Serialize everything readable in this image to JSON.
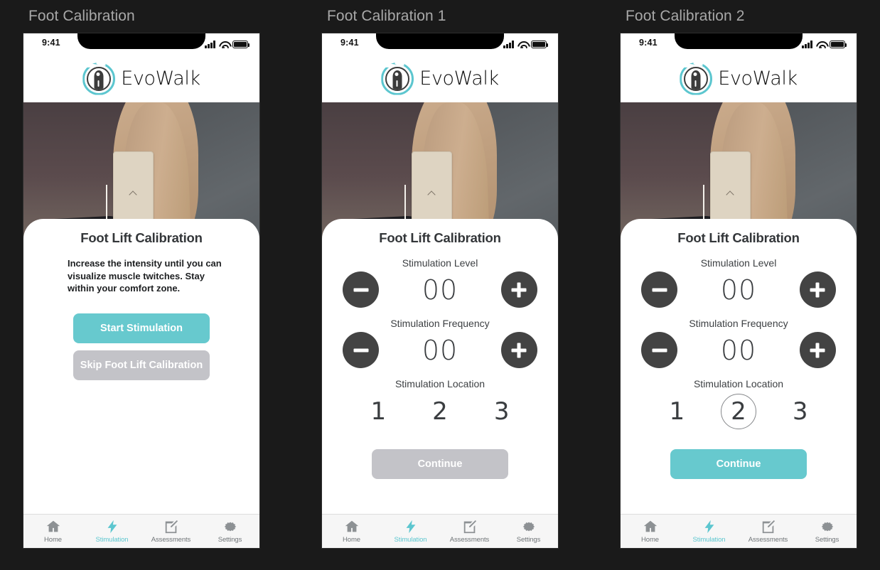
{
  "background_color": "#1a1a1a",
  "accent_color": "#67c9ce",
  "panels": [
    {
      "title": "Foot Calibration"
    },
    {
      "title": "Foot Calibration 1"
    },
    {
      "title": "Foot Calibration 2"
    }
  ],
  "status_bar": {
    "time": "9:41"
  },
  "brand": {
    "name": "EvoWalk"
  },
  "card_title": "Foot Lift Calibration",
  "screen1": {
    "description": "Increase the intensity until you can visualize muscle twitches. Stay within your comfort zone.",
    "start_button": "Start Stimulation",
    "skip_button": "Skip Foot Lift Calibration"
  },
  "screen2": {
    "level_label": "Stimulation Level",
    "level_value": "00",
    "frequency_label": "Stimulation Frequency",
    "frequency_value": "00",
    "location_label": "Stimulation Location",
    "location_options": [
      "1",
      "2",
      "3"
    ],
    "location_selected": null,
    "continue_button": "Continue",
    "continue_enabled": false
  },
  "screen3": {
    "level_label": "Stimulation Level",
    "level_value": "00",
    "frequency_label": "Stimulation Frequency",
    "frequency_value": "00",
    "location_label": "Stimulation Location",
    "location_options": [
      "1",
      "2",
      "3"
    ],
    "location_selected": "2",
    "continue_button": "Continue",
    "continue_enabled": true
  },
  "tabs": [
    {
      "label": "Home",
      "icon": "home-icon",
      "active": false
    },
    {
      "label": "Stimulation",
      "icon": "lightning-bolt-icon",
      "active": true
    },
    {
      "label": "Assessments",
      "icon": "edit-square-icon",
      "active": false
    },
    {
      "label": "Settings",
      "icon": "gear-icon",
      "active": false
    }
  ]
}
